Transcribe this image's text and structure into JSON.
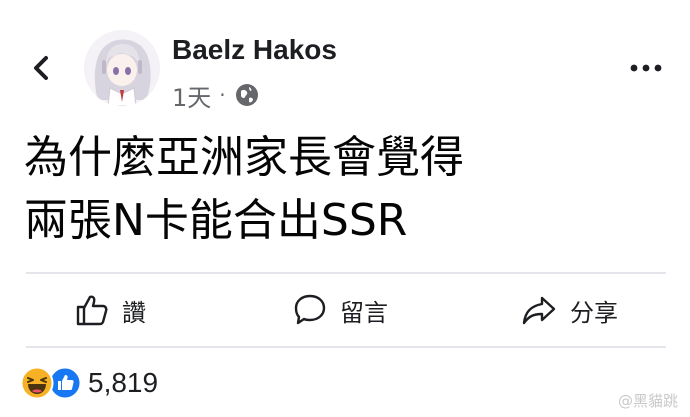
{
  "post": {
    "author": "Baelz Hakos",
    "time": "1天",
    "separator": "·",
    "privacy_icon": "globe-icon",
    "lines": [
      "為什麼亞洲家長會覺得",
      "兩張N卡能合出SSR"
    ]
  },
  "actions": {
    "like_label": "讚",
    "comment_label": "留言",
    "share_label": "分享"
  },
  "reactions": {
    "icons": [
      "haha-icon",
      "like-icon"
    ],
    "count": "5,819"
  },
  "watermark": {
    "text": "@黑貓跳"
  },
  "colors": {
    "text": "#1c1e21",
    "meta": "#65676b",
    "divider": "#e4e6eb",
    "like_blue": "#1877f2",
    "haha_yellow": "#f7b125"
  }
}
